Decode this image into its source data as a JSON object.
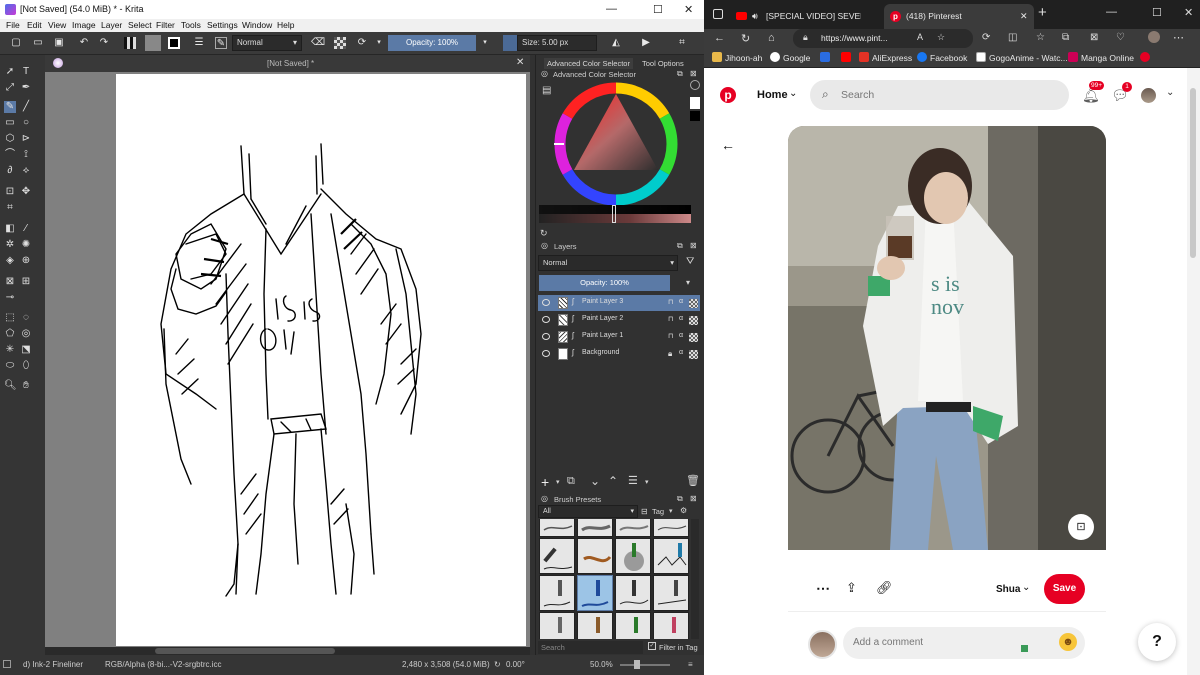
{
  "krita": {
    "title": "[Not Saved]  (54.0 MiB)  * - Krita",
    "menu": [
      "File",
      "Edit",
      "View",
      "Image",
      "Layer",
      "Select",
      "Filter",
      "Tools",
      "Settings",
      "Window",
      "Help"
    ],
    "toolbar": {
      "blend_mode": "Normal",
      "opacity": "Opacity: 100%",
      "size": "Size: 5.00 px"
    },
    "doc_tab": "[Not Saved]  *",
    "docker_tabs": [
      "Advanced Color Selector",
      "Tool Options"
    ],
    "color_selector_title": "Advanced Color Selector",
    "layers": {
      "title": "Layers",
      "blend": "Normal",
      "opacity": "Opacity:  100%",
      "items": [
        {
          "name": "Paint Layer 3",
          "selected": true
        },
        {
          "name": "Paint Layer 2",
          "selected": false
        },
        {
          "name": "Paint Layer 1",
          "selected": false
        },
        {
          "name": "Background",
          "selected": false
        }
      ]
    },
    "brush_presets": {
      "title": "Brush Presets",
      "filter": "All",
      "tag": "Tag",
      "search_placeholder": "Search",
      "filter_in_tag": "Filter in Tag"
    },
    "status": {
      "brush": "d) Ink-2 Fineliner",
      "color_space": "RGB/Alpha (8-bi...-V2-srgbtrc.icc",
      "dimensions": "2,480 x 3,508 (54.0 MiB)",
      "rotation": "0.00°",
      "zoom": "50.0%"
    }
  },
  "browser": {
    "tabs": [
      {
        "label": "[SPECIAL VIDEO] SEVENTEE",
        "active": false
      },
      {
        "label": "(418) Pinterest",
        "active": true
      }
    ],
    "url": "https://www.pint...",
    "bookmarks": [
      "Jihoon-ah",
      "Google",
      "",
      "",
      "AliExpress",
      "Facebook",
      "GogoAnime - Watc...",
      "Manga Online",
      ""
    ],
    "pinterest": {
      "nav_home": "Home",
      "search_placeholder": "Search",
      "notifications_badge": "99+",
      "messages_badge": "1",
      "board_name": "Shua",
      "save_label": "Save",
      "comment_placeholder": "Add a comment",
      "help_label": "?",
      "image_text": "s is\nnov"
    }
  },
  "colors": {
    "krita_dark": "#313131",
    "krita_highlight": "#5b7aa6",
    "pinterest_red": "#e60023",
    "browser_chrome": "#3b3b3b"
  }
}
